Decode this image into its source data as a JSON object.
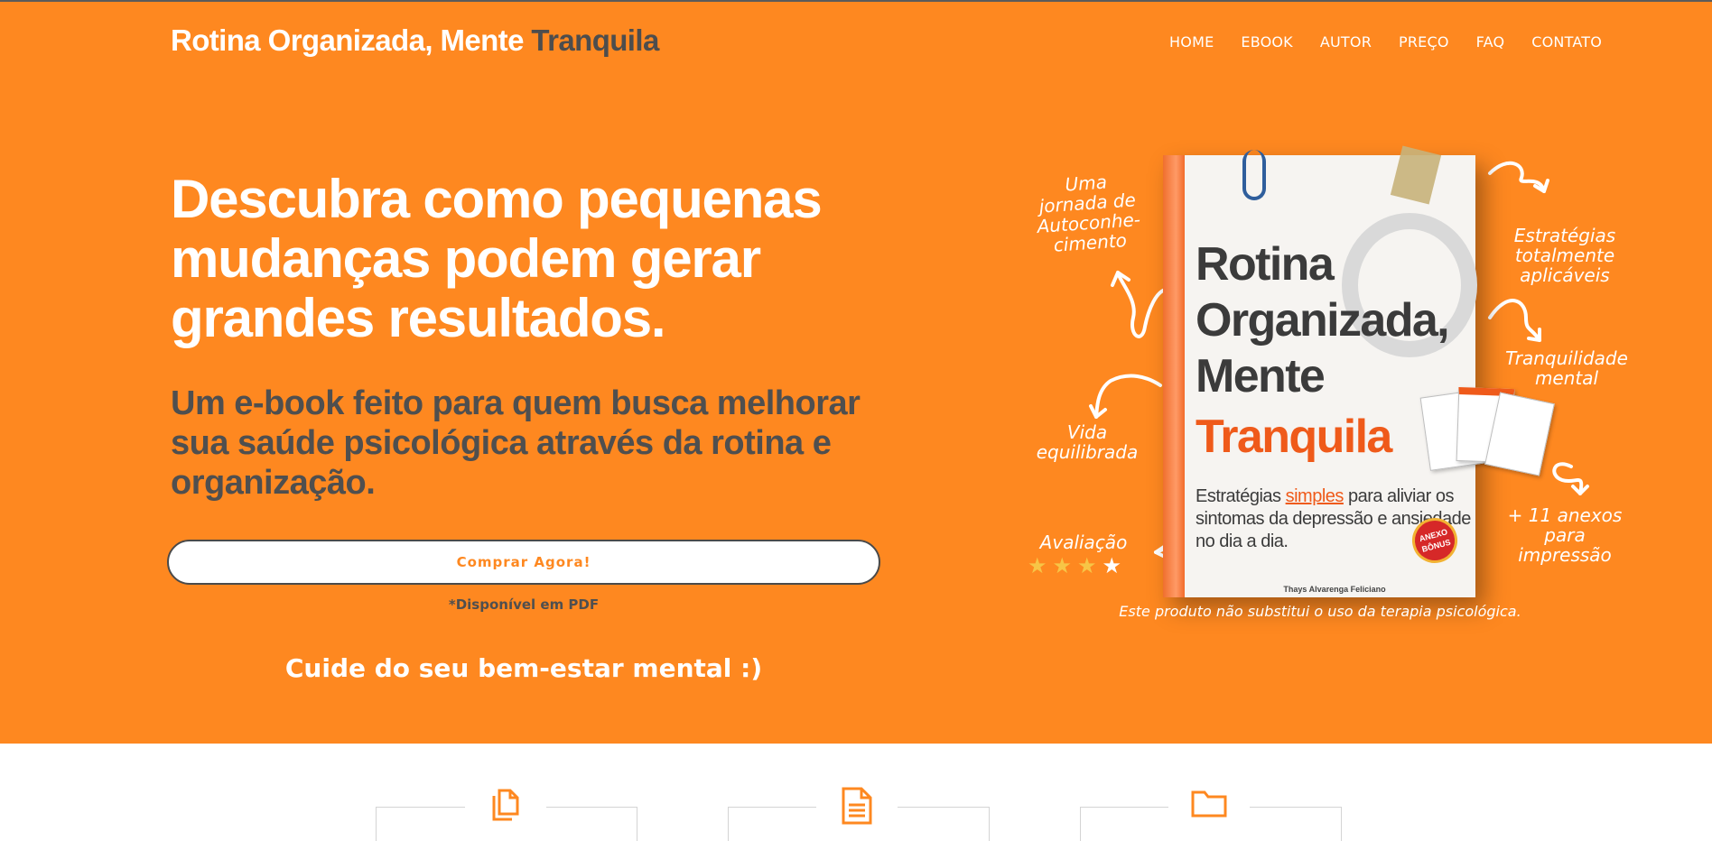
{
  "header": {
    "brand_main": "Rotina Organizada, Mente",
    "brand_accent": "Tranquila",
    "nav": [
      "HOME",
      "EBOOK",
      "AUTOR",
      "PREÇO",
      "FAQ",
      "CONTATO"
    ]
  },
  "hero": {
    "headline": "Descubra como pequenas mudanças podem gerar grandes resultados.",
    "subhead": "Um e-book feito para quem busca melhorar sua saúde psicológica através da rotina e organização.",
    "cta_label": "Comprar Agora!",
    "pdf_note": "*Disponível em PDF",
    "care_text": "Cuide do seu bem-estar mental :)"
  },
  "product": {
    "notes": {
      "journey": "Uma jornada de Autoconhe-cimento",
      "strategies": "Estratégias totalmente aplicáveis",
      "calm": "Tranquilidade mental",
      "balance": "Vida equilibrada",
      "annexes": "+ 11 anexos para impressão",
      "rating": "Avaliação"
    },
    "rating": {
      "filled": 3,
      "total": 4
    },
    "book": {
      "title": "Rotina Organizada, Mente",
      "title_accent": "Tranquila",
      "tagline_1": "Estratégias ",
      "tagline_highlight": "simples",
      "tagline_2": " para aliviar os sintomas da depressão e ansiedade no dia a dia.",
      "author": "Thays Alvarenga Feliciano",
      "seal": "ANEXO BÔNUS"
    },
    "disclaimer": "Este produto não substitui o uso da terapia psicológica."
  },
  "features": {
    "icons": [
      "copy-icon",
      "document-icon",
      "folder-icon"
    ]
  },
  "colors": {
    "accent": "#fe8820",
    "dark_text": "#4f4f4f",
    "book_accent": "#ef5a1a",
    "star": "#f7c546"
  }
}
